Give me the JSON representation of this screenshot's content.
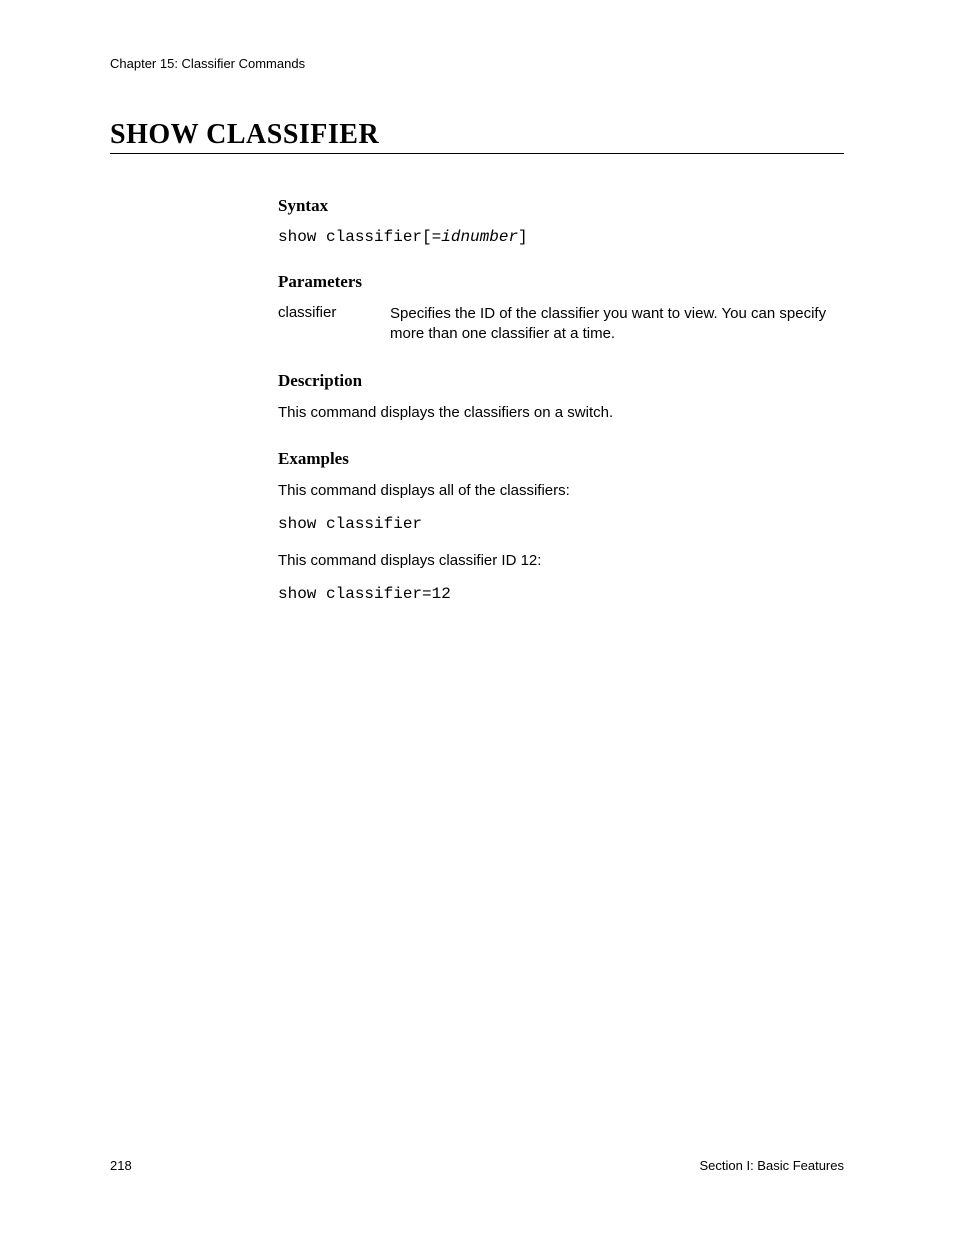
{
  "header": {
    "chapter": "Chapter 15: Classifier Commands"
  },
  "title": "SHOW CLASSIFIER",
  "sections": {
    "syntax": {
      "heading": "Syntax",
      "cmd_prefix": "show classifier[=",
      "cmd_var": "idnumber",
      "cmd_suffix": "]"
    },
    "parameters": {
      "heading": "Parameters",
      "rows": [
        {
          "name": "classifier",
          "desc": "Specifies the ID of the classifier you want to view. You can specify more than one classifier at a time."
        }
      ]
    },
    "description": {
      "heading": "Description",
      "text": "This command displays the classifiers on a switch."
    },
    "examples": {
      "heading": "Examples",
      "items": [
        {
          "text": "This command displays all of the classifiers:",
          "cmd": "show classifier"
        },
        {
          "text": "This command displays classifier ID 12:",
          "cmd": "show classifier=12"
        }
      ]
    }
  },
  "footer": {
    "page_number": "218",
    "section_label": "Section I: Basic Features"
  }
}
